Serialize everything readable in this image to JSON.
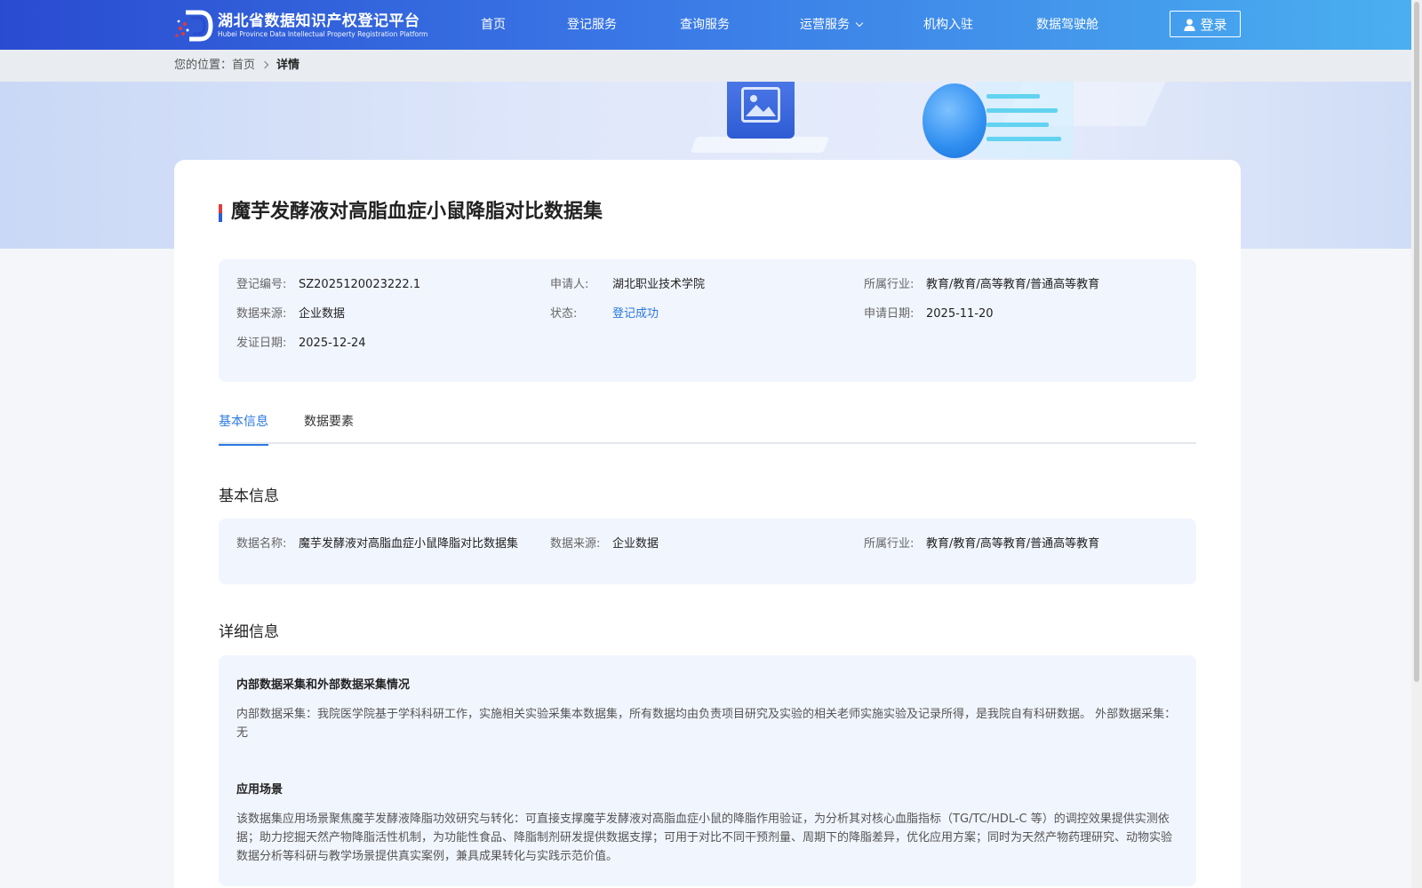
{
  "header": {
    "logo_cn": "湖北省数据知识产权登记平台",
    "logo_en": "Hubei Province Data Intellectual Property Registration Platform",
    "nav": [
      "首页",
      "登记服务",
      "查询服务",
      "运营服务",
      "机构入驻",
      "数据驾驶舱"
    ],
    "login_label": "登录",
    "colors": {
      "gradient_start": "#2a4bd0",
      "gradient_end": "#4ab0f0"
    }
  },
  "breadcrumb": {
    "prefix": "您的位置：",
    "home": "首页",
    "current": "详情"
  },
  "record": {
    "title": "魔芋发酵液对高脂血症小鼠降脂对比数据集",
    "summary": [
      {
        "label": "登记编号:",
        "value": "SZ2025120023222.1"
      },
      {
        "label": "申请人:",
        "value": "湖北职业技术学院"
      },
      {
        "label": "所属行业:",
        "value": "教育/教育/高等教育/普通高等教育"
      },
      {
        "label": "数据来源:",
        "value": "企业数据"
      },
      {
        "label": "状态:",
        "value": "登记成功"
      },
      {
        "label": "申请日期:",
        "value": "2025-11-20"
      },
      {
        "label": "发证日期:",
        "value": "2025-12-24"
      }
    ]
  },
  "tabs": [
    "基本信息",
    "数据要素"
  ],
  "basic": {
    "section_title": "基本信息",
    "fields": [
      {
        "label": "数据名称:",
        "value": "魔芋发酵液对高脂血症小鼠降脂对比数据集"
      },
      {
        "label": "数据来源:",
        "value": "企业数据"
      },
      {
        "label": "所属行业:",
        "value": "教育/教育/高等教育/普通高等教育"
      }
    ]
  },
  "detail": {
    "section_title": "详细信息",
    "blocks": [
      {
        "heading": "内部数据采集和外部数据采集情况",
        "text": "内部数据采集：我院医学院基于学科科研工作，实施相关实验采集本数据集，所有数据均由负责项目研究及实验的相关老师实施实验及记录所得，是我院自有科研数据。 外部数据采集：无"
      },
      {
        "heading": "应用场景",
        "text": "该数据集应用场景聚焦魔芋发酵液降脂功效研究与转化：可直接支撑魔芋发酵液对高脂血症小鼠的降脂作用验证，为分析其对核心血脂指标（TG/TC/HDL-C 等）的调控效果提供实测依据；助力挖掘天然产物降脂活性机制，为功能性食品、降脂制剂研发提供数据支撑；可用于对比不同干预剂量、周期下的降脂差异，优化应用方案；同时为天然产物药理研究、动物实验数据分析等科研与教学场景提供真实案例，兼具成果转化与实践示范价值。"
      }
    ]
  }
}
